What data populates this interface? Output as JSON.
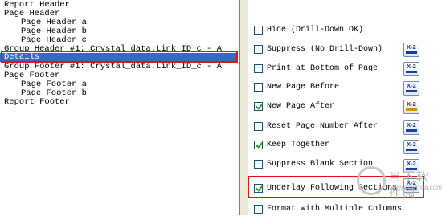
{
  "sections": [
    {
      "label": "Report Header",
      "indent": 0
    },
    {
      "label": "Page Header",
      "indent": 0
    },
    {
      "label": "Page Header a",
      "indent": 1
    },
    {
      "label": "Page Header b",
      "indent": 1
    },
    {
      "label": "Page Header c",
      "indent": 1
    },
    {
      "label": "Group Header #1: Crystal_data.Link_ID_c - A",
      "indent": 0
    },
    {
      "label": "Details",
      "indent": 0,
      "selected": true
    },
    {
      "label": "Group Footer #1: Crystal_data.Link_ID_c - A",
      "indent": 0
    },
    {
      "label": "Page Footer",
      "indent": 0
    },
    {
      "label": "Page Footer a",
      "indent": 1
    },
    {
      "label": "Page Footer b",
      "indent": 1
    },
    {
      "label": "Report Footer",
      "indent": 0
    }
  ],
  "options": [
    {
      "label": "Hide (Drill-Down OK)",
      "checked": false,
      "formula": false
    },
    {
      "label": "Suppress (No Drill-Down)",
      "checked": false,
      "formula": true
    },
    {
      "label": "Print at Bottom of Page",
      "checked": false,
      "formula": true
    },
    {
      "label": "New Page Before",
      "checked": false,
      "formula": true
    },
    {
      "label": "New Page After",
      "checked": true,
      "formula": true,
      "formula_style": "alt"
    },
    {
      "label": "Reset Page Number After",
      "checked": false,
      "formula": true
    },
    {
      "label": "Keep Together",
      "checked": true,
      "formula": true
    },
    {
      "label": "Suppress Blank Section",
      "checked": false,
      "formula": true
    },
    {
      "label": "Underlay Following Sections",
      "checked": true,
      "formula": true
    },
    {
      "label": "Format with Multiple Columns",
      "checked": false,
      "formula": false
    }
  ],
  "formula_button": {
    "label": "X-2",
    "icon": "formula-icon"
  },
  "watermark": {
    "text": "当下软件园",
    "url": "www.downxia.com"
  },
  "colors": {
    "selection": "#3569c2",
    "highlight_box": "#e0141a",
    "check": "#21a121",
    "panel": "#ece9d8"
  }
}
